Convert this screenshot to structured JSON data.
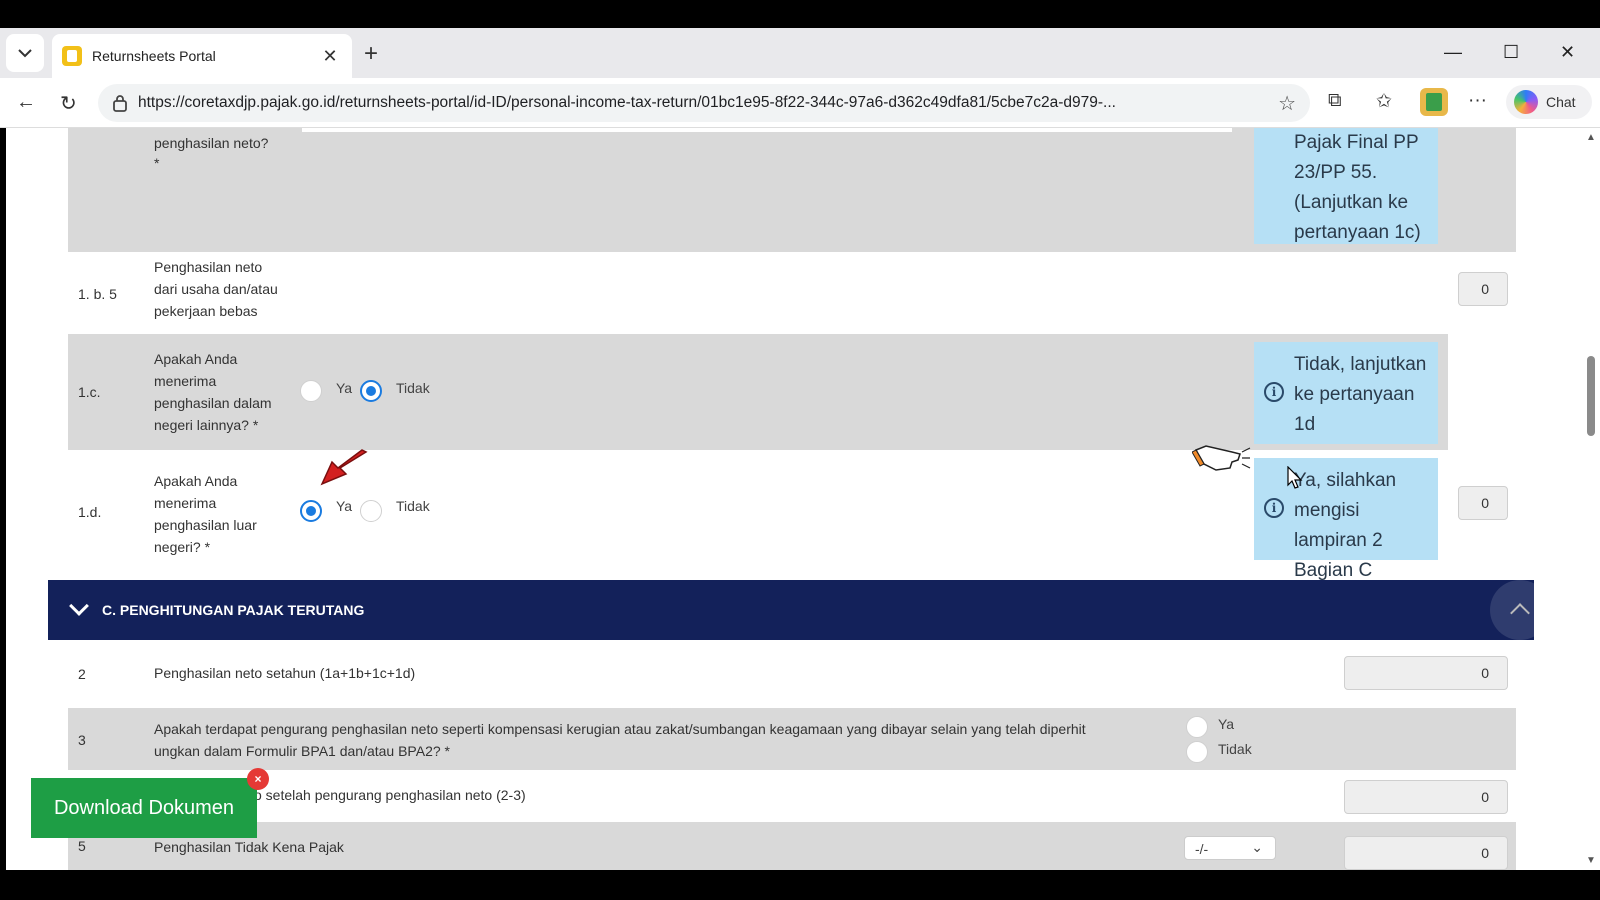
{
  "browser": {
    "tab_title": "Returnsheets Portal",
    "url": "https://coretaxdjp.pajak.go.id/returnsheets-portal/id-ID/personal-income-tax-return/01bc1e95-8f22-344c-97a6-d362c49dfa81/5cbe7c2a-d979-...",
    "chat_label": "Chat"
  },
  "rows": {
    "top": {
      "question": "penghasilan neto?",
      "required": "*",
      "info": "Pajak Final PP 23/PP 55. (Lanjutkan ke pertanyaan 1c)"
    },
    "b5": {
      "num": "1. b. 5",
      "question": "Penghasilan neto dari usaha dan/atau pekerjaan bebas",
      "value": "0"
    },
    "c": {
      "num": "1.c.",
      "question": "Apakah Anda menerima penghasilan dalam negeri lainnya? *",
      "yes": "Ya",
      "no": "Tidak",
      "selected": "Tidak",
      "info": "Tidak, lanjutkan ke pertanyaan 1d"
    },
    "d": {
      "num": "1.d.",
      "question": "Apakah Anda menerima penghasilan luar negeri? *",
      "yes": "Ya",
      "no": "Tidak",
      "selected": "Ya",
      "info": "Ya, silahkan mengisi lampiran 2 Bagian C",
      "value": "0"
    }
  },
  "section": {
    "title": "C. PENGHITUNGAN PAJAK TERUTANG"
  },
  "calc": {
    "r2": {
      "num": "2",
      "label": "Penghasilan neto setahun (1a+1b+1c+1d)",
      "value": "0"
    },
    "r3": {
      "num": "3",
      "label_line1": "Apakah terdapat pengurang penghasilan neto seperti kompensasi kerugian atau zakat/sumbangan keagamaan yang dibayar selain yang telah diperhit",
      "label_line2": "ungkan dalam Formulir BPA1 dan/atau BPA2? *",
      "yes": "Ya",
      "no": "Tidak"
    },
    "r4": {
      "label": "o setelah pengurang penghasilan neto (2-3)",
      "value": "0"
    },
    "r5": {
      "num": "5",
      "label": "Penghasilan Tidak Kena Pajak",
      "select": "-/-",
      "value": "0"
    }
  },
  "download": {
    "label": "Download Dokumen",
    "close": "×"
  }
}
